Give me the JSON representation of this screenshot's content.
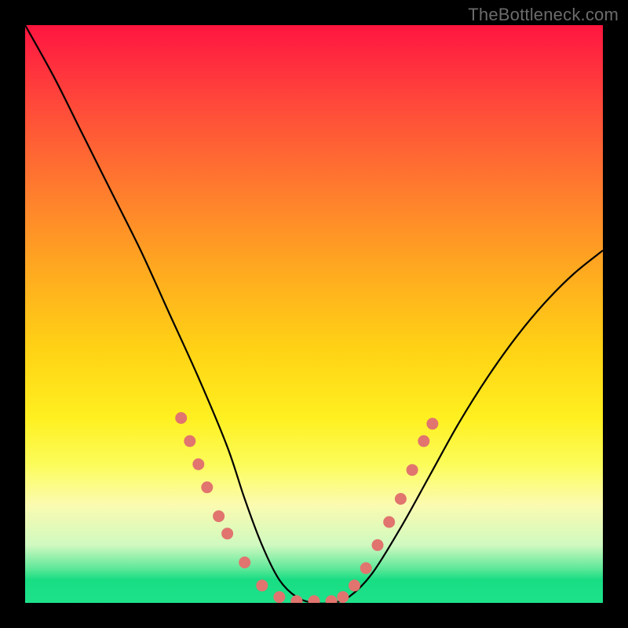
{
  "watermark": "TheBottleneck.com",
  "chart_data": {
    "type": "line",
    "title": "",
    "xlabel": "",
    "ylabel": "",
    "xlim": [
      0,
      100
    ],
    "ylim": [
      0,
      100
    ],
    "series": [
      {
        "name": "bottleneck-curve",
        "x": [
          0,
          5,
          10,
          15,
          20,
          25,
          30,
          35,
          38,
          41,
          44,
          47,
          50,
          53,
          56,
          60,
          65,
          70,
          75,
          80,
          85,
          90,
          95,
          100
        ],
        "y": [
          100,
          91,
          81,
          71,
          61,
          50,
          39,
          27,
          18,
          10,
          4,
          1,
          0,
          0,
          1,
          5,
          13,
          22,
          31,
          39,
          46,
          52,
          57,
          61
        ]
      }
    ],
    "markers": {
      "name": "highlight-dots",
      "color": "#e1746e",
      "points": [
        {
          "x": 27,
          "y": 32
        },
        {
          "x": 28.5,
          "y": 28
        },
        {
          "x": 30,
          "y": 24
        },
        {
          "x": 31.5,
          "y": 20
        },
        {
          "x": 33.5,
          "y": 15
        },
        {
          "x": 35,
          "y": 12
        },
        {
          "x": 38,
          "y": 7
        },
        {
          "x": 41,
          "y": 3
        },
        {
          "x": 44,
          "y": 1
        },
        {
          "x": 47,
          "y": 0.3
        },
        {
          "x": 50,
          "y": 0.3
        },
        {
          "x": 53,
          "y": 0.3
        },
        {
          "x": 55,
          "y": 1
        },
        {
          "x": 57,
          "y": 3
        },
        {
          "x": 59,
          "y": 6
        },
        {
          "x": 61,
          "y": 10
        },
        {
          "x": 63,
          "y": 14
        },
        {
          "x": 65,
          "y": 18
        },
        {
          "x": 67,
          "y": 23
        },
        {
          "x": 69,
          "y": 28
        },
        {
          "x": 70.5,
          "y": 31
        }
      ]
    },
    "gradient_stops": [
      {
        "pos": 0,
        "color": "#ff153e"
      },
      {
        "pos": 50,
        "color": "#ffd215"
      },
      {
        "pos": 80,
        "color": "#fcfc5a"
      },
      {
        "pos": 100,
        "color": "#1ee28a"
      }
    ]
  }
}
